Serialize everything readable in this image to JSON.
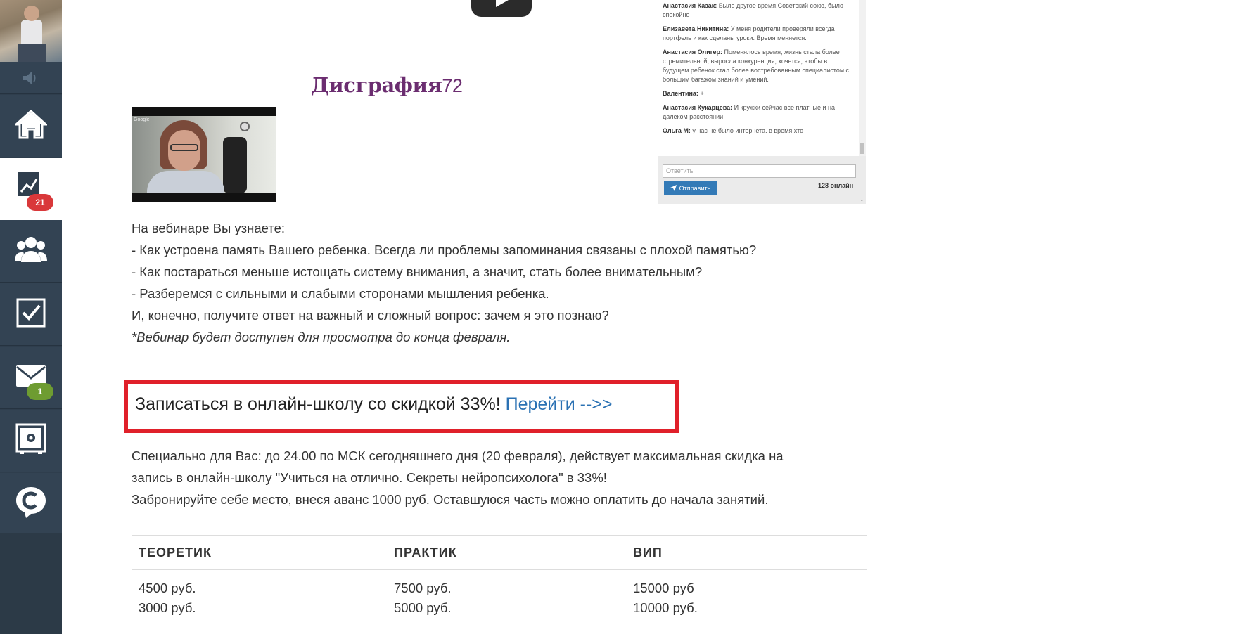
{
  "sidebar": {
    "items": [
      {
        "icon": "home-icon"
      },
      {
        "icon": "chart-icon",
        "badge": "21",
        "active": true
      },
      {
        "icon": "users-icon"
      },
      {
        "icon": "checkbox-icon"
      },
      {
        "icon": "mail-icon",
        "badge": "1"
      },
      {
        "icon": "safe-icon"
      },
      {
        "icon": "chat-logo-icon"
      }
    ]
  },
  "logo": {
    "text": "Дисграфия",
    "number": "72"
  },
  "chat": {
    "messages": [
      {
        "author": "Анастасия Казак:",
        "text": "Было другое время.Советский союз, было спокойно"
      },
      {
        "author": "Елизавета Никитина:",
        "text": "У меня родители проверяли всегда портфель и как сделаны уроки. Время меняется."
      },
      {
        "author": "Анастасия Олигер:",
        "text": "Поменялось время, жизнь стала более стремительной, выросла конкуренция, хочется, чтобы в будущем ребенок стал более востребованным специалистом с большим багажом знаний и умений."
      },
      {
        "author": "Валентина:",
        "text": "+"
      },
      {
        "author": "Анастасия Кукарцева:",
        "text": "И кружки сейчас все платные и на далеком расстоянии"
      },
      {
        "author": "Ольга М:",
        "text": "у нас не было интернета. в время хто"
      }
    ],
    "input_placeholder": "Ответить",
    "send_label": "Отправить",
    "online": "128 онлайн"
  },
  "video": {
    "tag": "Google"
  },
  "content": {
    "intro": "На вебинаре Вы узнаете:",
    "bullets": [
      "- Как устроена память Вашего ребенка. Всегда ли проблемы запоминания связаны с плохой памятью?",
      "- Как постараться меньше истощать систему внимания, а значит, стать более внимательным?",
      "- Разберемся с сильными и слабыми сторонами мышления ребенка."
    ],
    "closing": "И, конечно, получите ответ на важный и сложный вопрос: зачем я это познаю?",
    "note": "*Вебинар будет доступен для просмотра до конца февраля."
  },
  "cta": {
    "text": "Записаться в онлайн-школу со скидкой 33%!",
    "link": "Перейти -->>"
  },
  "promo": {
    "line1": "Специально для Вас: до 24.00 по МСК сегодняшнего дня (20 февраля), действует максимальная скидка на",
    "line2": "запись в онлайн-школу \"Учиться на отлично. Секреты нейропсихолога\" в 33%!",
    "line3": "Забронируйте себе место, внеся аванс 1000 руб. Оставшуюся часть можно оплатить до начала занятий."
  },
  "pricing": {
    "headers": [
      "ТЕОРЕТИК",
      "ПРАКТИК",
      "ВИП"
    ],
    "old_prices": [
      "4500 руб.",
      "7500 руб.",
      "15000 руб"
    ],
    "new_prices": [
      "3000 руб.",
      "5000 руб.",
      "10000 руб."
    ]
  },
  "colors": {
    "sidebar": "#334353",
    "badge_red": "#d9383a",
    "badge_green": "#6e9c31",
    "cta_border": "#e0202a",
    "link": "#2a71b3"
  }
}
